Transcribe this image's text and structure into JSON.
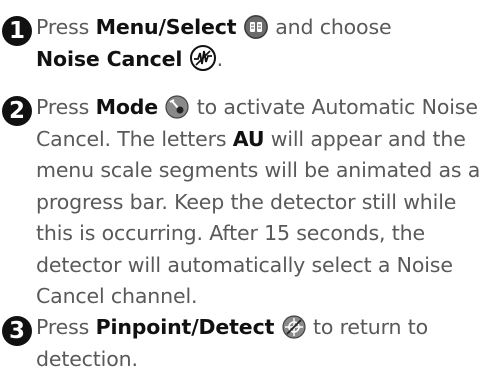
{
  "steps": [
    {
      "number": "1",
      "pre": "Press ",
      "button": "Menu/Select",
      "icon": "menu-select-icon",
      "mid": " and choose",
      "option": "Noise Cancel",
      "option_icon": "noise-cancel-icon",
      "end": "."
    },
    {
      "number": "2",
      "pre": "Press ",
      "button": "Mode",
      "icon": "mode-icon",
      "mid": " to activate Automatic Noise Cancel. The letters ",
      "code": "AU",
      "rest": " will appear and the menu scale segments will be animated as a progress bar. Keep the detector still while this is occurring. After 15 seconds, the detector will automatically select a Noise Cancel channel."
    },
    {
      "number": "3",
      "pre": "Press ",
      "button": "Pinpoint/Detect",
      "icon": "pinpoint-detect-icon",
      "rest": " to return to detection."
    }
  ],
  "colors": {
    "number_badge": "#111111",
    "text": "#58595b",
    "bold": "#111111"
  }
}
